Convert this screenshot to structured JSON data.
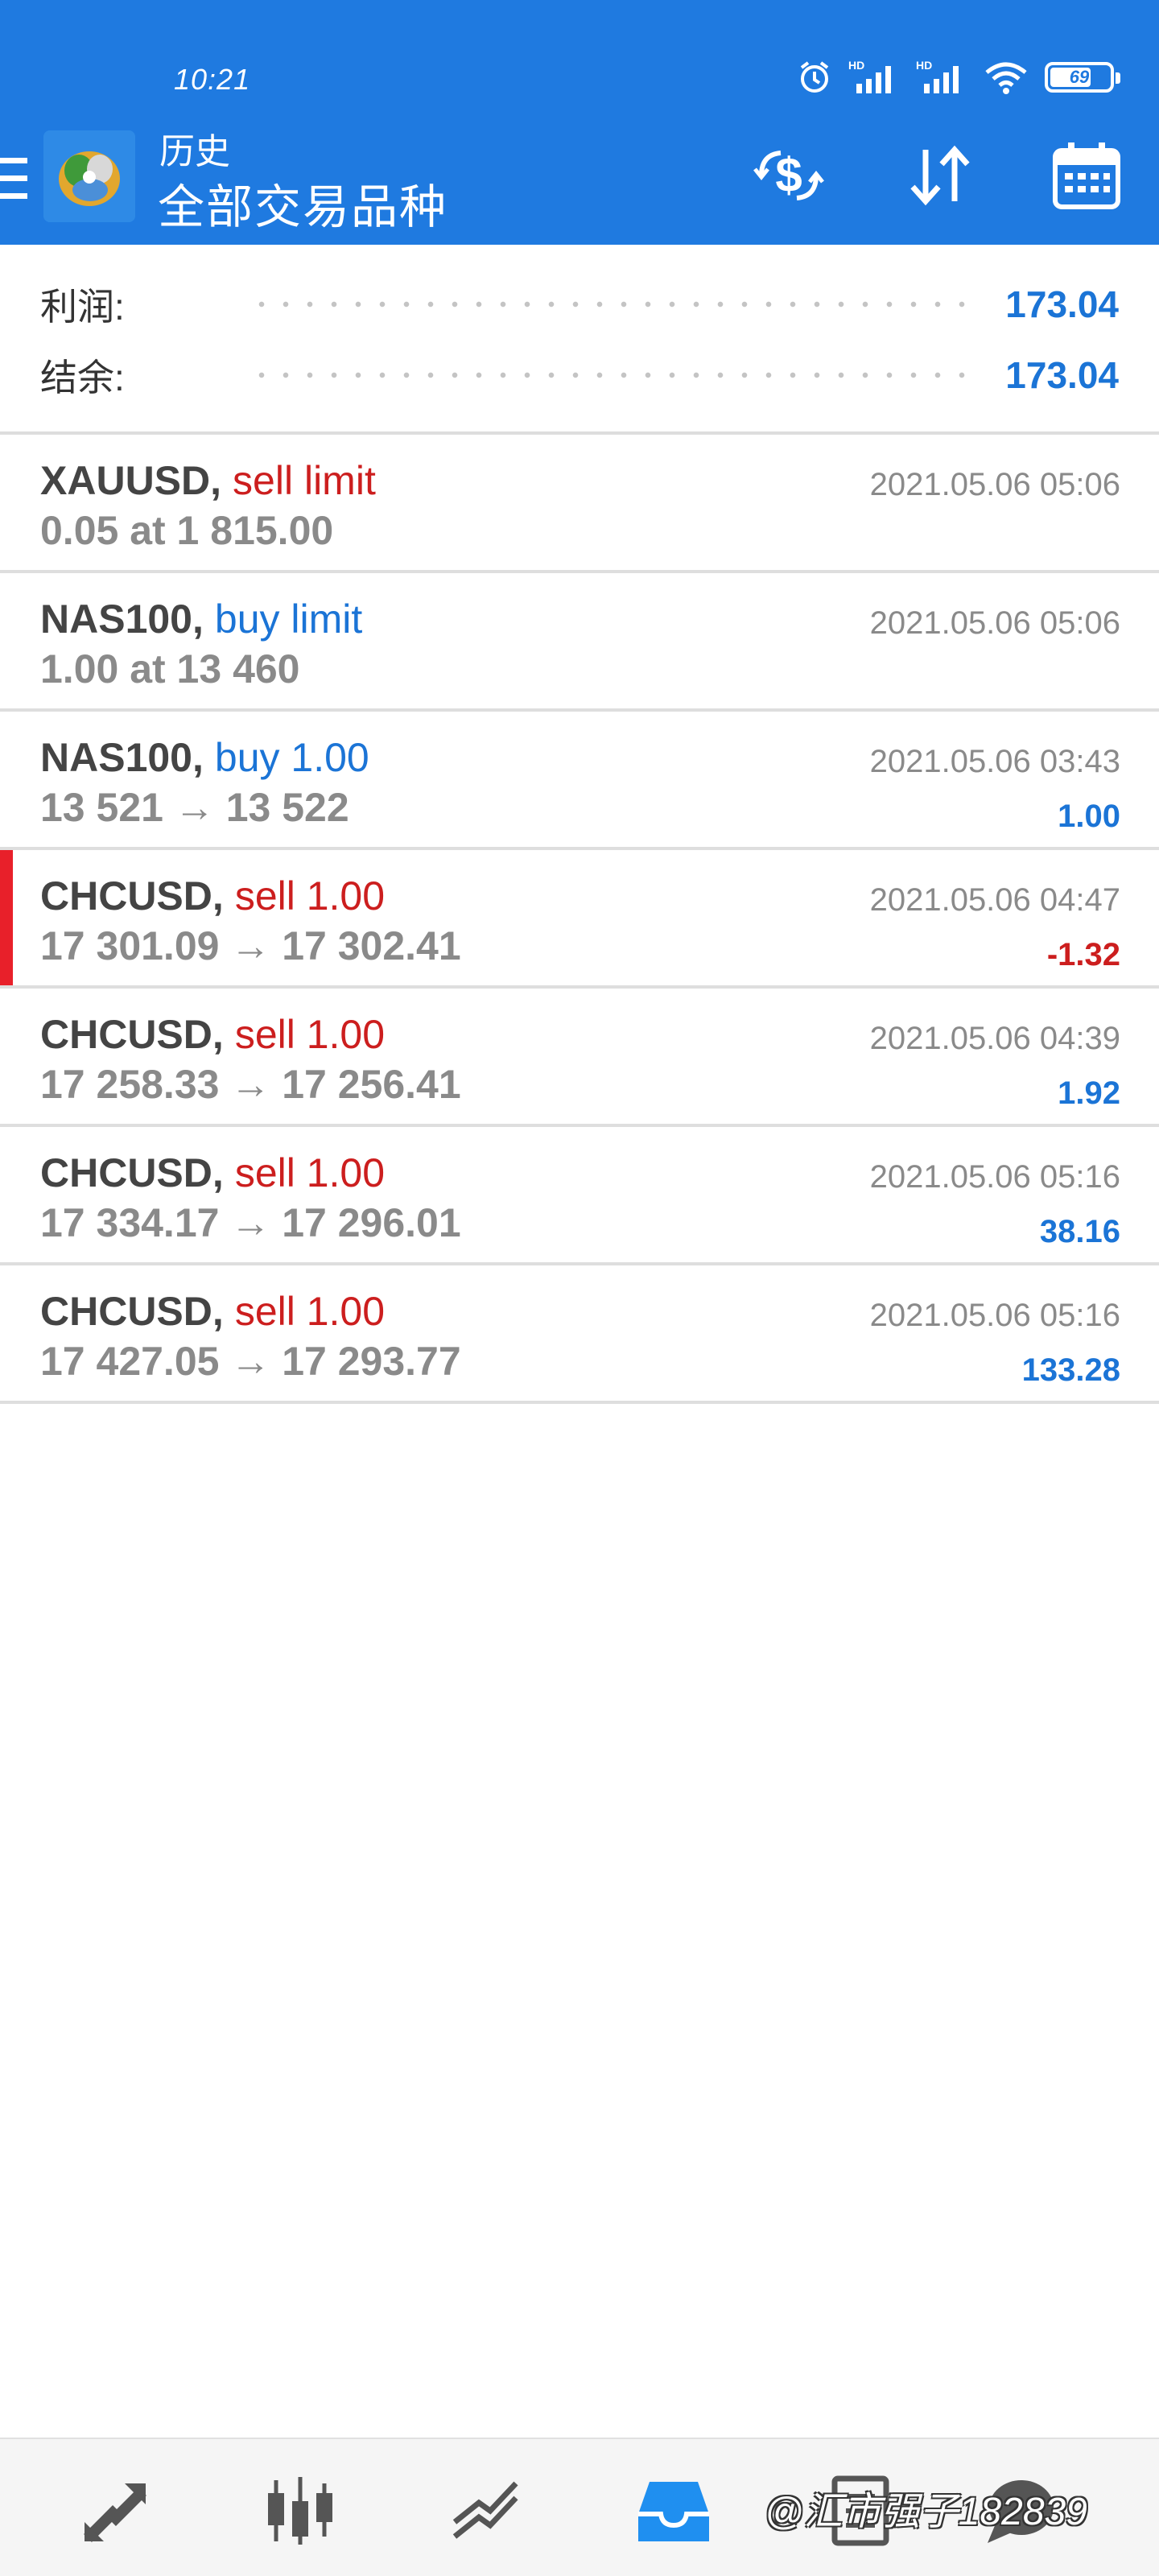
{
  "status_bar": {
    "time": "10:21",
    "battery_text": "69",
    "battery_level": 0.69,
    "icons": [
      "alarm-icon",
      "hd-signal-icon",
      "hd-signal-icon",
      "wifi-icon",
      "battery-icon"
    ]
  },
  "header": {
    "title": "历史",
    "subtitle": "全部交易品种",
    "actions": [
      "currency-exchange-icon",
      "sort-icon",
      "calendar-icon"
    ]
  },
  "summary": {
    "profit_label": "利润:",
    "profit_value": "173.04",
    "balance_label": "结余:",
    "balance_value": "173.04"
  },
  "trades": [
    {
      "symbol": "XAUUSD",
      "action": "sell limit",
      "side": "sell",
      "detail": "0.05 at 1 815.00",
      "time": "2021.05.06 05:06",
      "pl": "",
      "pl_sign": "",
      "flagged": false
    },
    {
      "symbol": "NAS100",
      "action": "buy limit",
      "side": "buy",
      "detail": "1.00 at 13 460",
      "time": "2021.05.06 05:06",
      "pl": "",
      "pl_sign": "",
      "flagged": false
    },
    {
      "symbol": "NAS100",
      "action": "buy 1.00",
      "side": "buy",
      "detail": "13 521 → 13 522",
      "time": "2021.05.06 03:43",
      "pl": "1.00",
      "pl_sign": "pos",
      "flagged": false
    },
    {
      "symbol": "CHCUSD",
      "action": "sell 1.00",
      "side": "sell",
      "detail": "17 301.09 → 17 302.41",
      "time": "2021.05.06 04:47",
      "pl": "-1.32",
      "pl_sign": "neg",
      "flagged": true
    },
    {
      "symbol": "CHCUSD",
      "action": "sell 1.00",
      "side": "sell",
      "detail": "17 258.33 → 17 256.41",
      "time": "2021.05.06 04:39",
      "pl": "1.92",
      "pl_sign": "pos",
      "flagged": false
    },
    {
      "symbol": "CHCUSD",
      "action": "sell 1.00",
      "side": "sell",
      "detail": "17 334.17 → 17 296.01",
      "time": "2021.05.06 05:16",
      "pl": "38.16",
      "pl_sign": "pos",
      "flagged": false
    },
    {
      "symbol": "CHCUSD",
      "action": "sell 1.00",
      "side": "sell",
      "detail": "17 427.05 → 17 293.77",
      "time": "2021.05.06 05:16",
      "pl": "133.28",
      "pl_sign": "pos",
      "flagged": false
    }
  ],
  "bottom_nav": {
    "items": [
      "quotes-icon",
      "chart-icon",
      "trade-icon",
      "history-icon",
      "news-icon",
      "chat-icon"
    ],
    "active": "history-icon"
  },
  "watermark": "@汇市强子182839",
  "colors": {
    "header_blue": "#1f7ae0",
    "sell_red": "#cc1e1e",
    "buy_blue": "#1b74d6",
    "flag_red": "#e8202a"
  }
}
